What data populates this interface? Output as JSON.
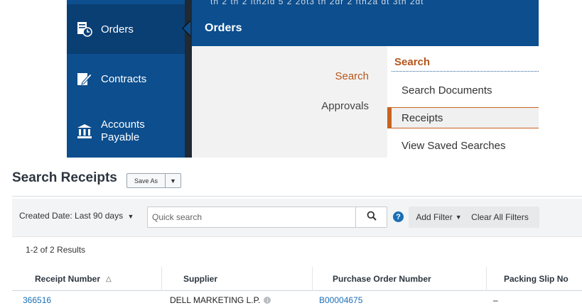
{
  "sidebar": {
    "items": [
      {
        "label": "Orders",
        "icon": "orders-icon"
      },
      {
        "label": "Contracts",
        "icon": "contracts-icon"
      },
      {
        "label_line1": "Accounts",
        "label_line2": "Payable",
        "icon": "bank-icon"
      }
    ]
  },
  "blurred_text": "th 2 th 2 ith2ld 5 2 2ot3 th 2dr 2 fth2a dt 3th 2dt",
  "menu": {
    "title": "Orders",
    "categories": [
      "Search",
      "Approvals"
    ],
    "section_title": "Search",
    "items": [
      "Search Documents",
      "Receipts",
      "View Saved Searches"
    ]
  },
  "page": {
    "title": "Search Receipts",
    "save_as": "Save As"
  },
  "toolbar": {
    "date_filter": "Created Date: Last 90 days",
    "quick_search_placeholder": "Quick search",
    "add_filter": "Add Filter",
    "clear_filters": "Clear All Filters",
    "help": "?"
  },
  "results": {
    "count": "1-2 of 2 Results",
    "columns": [
      "Receipt Number",
      "Supplier",
      "Purchase Order Number",
      "Packing Slip No"
    ],
    "rows": [
      {
        "receipt": "366516",
        "supplier": "DELL MARKETING L.P.",
        "po": "B00004675",
        "packing": "–"
      }
    ]
  },
  "colors": {
    "nav_blue": "#0c4e8e",
    "accent_orange": "#c8631e",
    "link_blue": "#1a6fb5"
  }
}
